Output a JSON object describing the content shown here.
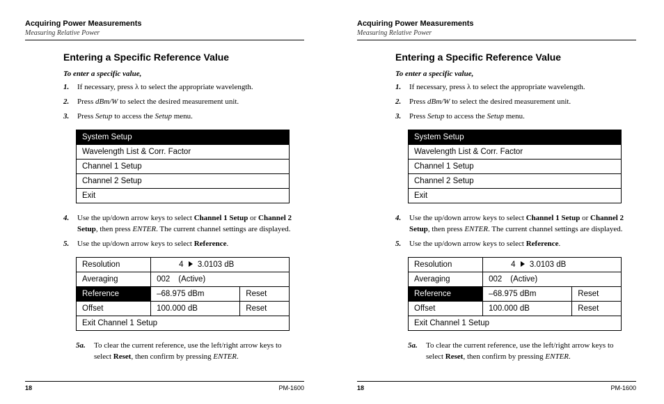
{
  "header": {
    "title": "Acquiring Power Measurements",
    "subtitle": "Measuring Relative Power"
  },
  "section": {
    "title": "Entering a Specific Reference Value",
    "lead": "To enter a specific value,"
  },
  "steps": {
    "s1a": "If necessary, press ",
    "s1b": " to select the appropriate wavelength.",
    "s2a": "Press ",
    "s2b": "dBm/W",
    "s2c": " to select the desired measurement unit.",
    "s3a": "Press ",
    "s3b": "Setup",
    "s3c": " to access the ",
    "s3d": "Setup",
    "s3e": " menu.",
    "s4a": "Use the up/down arrow keys to select ",
    "s4b": "Channel 1 Setup",
    "s4c": " or ",
    "s4d": "Channel 2 Setup",
    "s4e": ", then press ",
    "s4f": "ENTER",
    "s4g": ". The current channel settings are displayed.",
    "s5a": "Use the up/down arrow keys to select ",
    "s5b": "Reference",
    "s5c": "."
  },
  "nums": {
    "n1": "1.",
    "n2": "2.",
    "n3": "3.",
    "n4": "4.",
    "n5": "5.",
    "n5a": "5a."
  },
  "lambda": "λ",
  "menu1": {
    "header": "System Setup",
    "r1": "Wavelength List & Corr. Factor",
    "r2": "Channel 1 Setup",
    "r3": "Channel 2 Setup",
    "r4": "Exit"
  },
  "menu2": {
    "r1a": "Resolution",
    "r1b": "4",
    "r1c": "3.0103 dB",
    "r2a": "Averaging",
    "r2b": "002",
    "r2c": "(Active)",
    "r3a": "Reference",
    "r3b": "–68.975 dBm",
    "r3c": "Reset",
    "r4a": "Offset",
    "r4b": "100.000 dB",
    "r4c": "Reset",
    "r5a": "Exit Channel 1 Setup"
  },
  "substep": {
    "a": "To clear the current reference, use the left/right arrow keys to select ",
    "b": "Reset",
    "c": ", then confirm by pressing ",
    "d": "ENTER",
    "e": "."
  },
  "footer": {
    "page": "18",
    "model": "PM-1600"
  }
}
